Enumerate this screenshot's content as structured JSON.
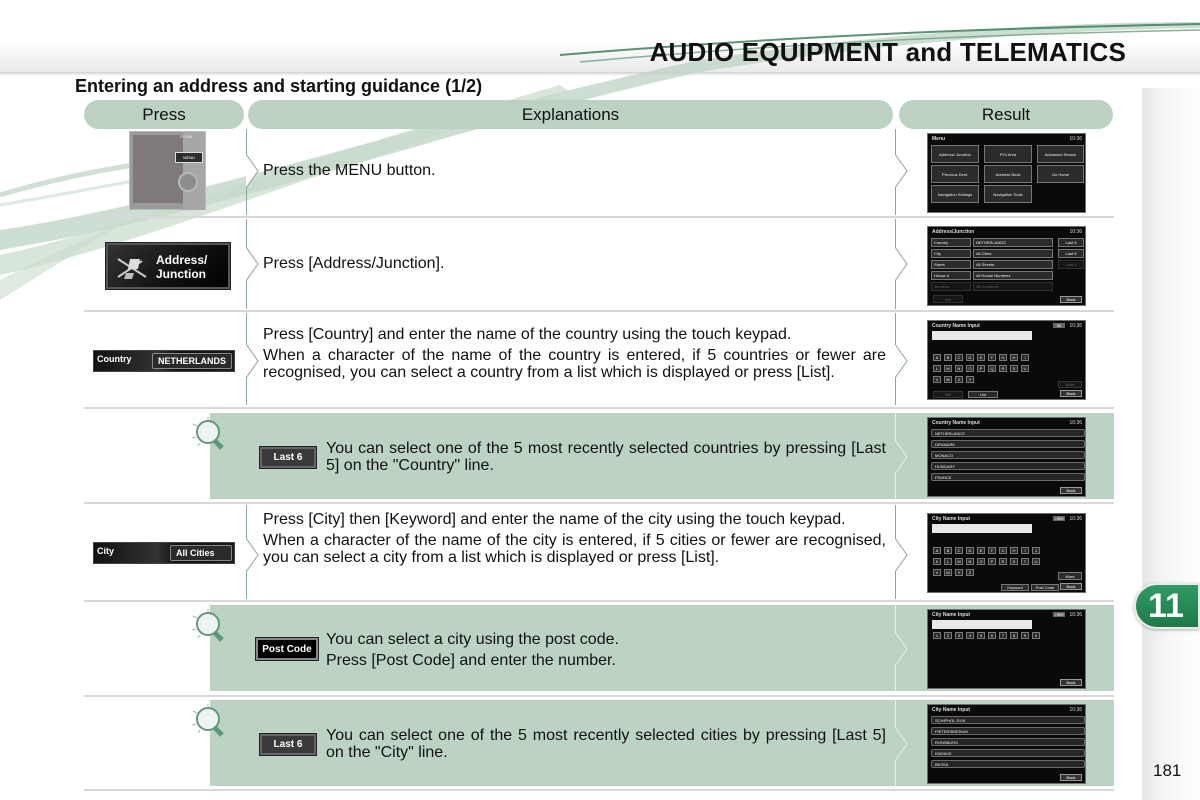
{
  "header": {
    "title": "AUDIO EQUIPMENT and TELEMATICS"
  },
  "section": {
    "title": "Entering an address and starting guidance (1/2)"
  },
  "columns": {
    "press": "Press",
    "explanations": "Explanations",
    "result": "Result"
  },
  "rows": [
    {
      "press": {
        "type": "device",
        "label": "MENU",
        "top_label": "ZOOM"
      },
      "explanations": [
        "Press the MENU button."
      ],
      "result": {
        "title": "Menu",
        "time": "10:36",
        "buttons": [
          "Address/ Junction",
          "POI Area",
          "Advanced Search",
          "Previous Dest.",
          "Address Book",
          "Go Home",
          "Navigation Settings",
          "Navigation Tools"
        ]
      }
    },
    {
      "press": {
        "type": "button",
        "label": "Address/ Junction"
      },
      "explanations": [
        "Press [Address/Junction]."
      ],
      "result": {
        "title": "Address/Junction",
        "time": "10:36",
        "fields": [
          {
            "label": "Country",
            "value": "NETHERLANDS",
            "action": "Last 5"
          },
          {
            "label": "City",
            "value": "All Cities",
            "action": "Last 5"
          },
          {
            "label": "Street",
            "value": "All Streets",
            "action": "Last 5"
          },
          {
            "label": "House #",
            "value": "All House Numbers",
            "action": ""
          },
          {
            "label": "Junction",
            "value": "All Junctions",
            "action": ""
          }
        ],
        "set": "Set",
        "back": "Back"
      }
    },
    {
      "press": {
        "type": "field",
        "label": "Country",
        "value": "NETHERLANDS"
      },
      "explanations": [
        "Press [Country] and enter the name of the country using the touch keypad.",
        "When a character of the name of the country is entered, if 5 countries or fewer are recognised, you can select a country from a list which is displayed or press [List]."
      ],
      "result": {
        "title": "Country Name Input",
        "time": "10:36",
        "badge": "52",
        "keys": [
          "A",
          "B",
          "C",
          "D",
          "E",
          "F",
          "G",
          "H",
          "I",
          "L",
          "M",
          "N",
          "O",
          "P",
          "Q",
          "R",
          "S",
          "U",
          "V",
          "W",
          "X",
          "Y"
        ],
        "set": "Set",
        "list": "List",
        "more": "More",
        "back": "Back"
      }
    },
    {
      "tip": true,
      "press": {
        "type": "button",
        "label": "Last 6"
      },
      "explanations": [
        "You can select one of the 5 most recently selected countries by pressing [Last 5] on the \"Country\" line."
      ],
      "result": {
        "title": "Country Name Input",
        "time": "10:36",
        "items": [
          "NETHERLANDS",
          "DENMARK",
          "MONACO",
          "HUNGARY",
          "FRANCE"
        ],
        "back": "Back"
      }
    },
    {
      "press": {
        "type": "field",
        "label": "City",
        "value": "All Cities"
      },
      "explanations": [
        "Press [City] then [Keyword] and enter the name of the city using the touch keypad.",
        "When a character of the name of the city is entered, if 5 cities or fewer are recognised, you can select a city from a list which is displayed or press [List]."
      ],
      "result": {
        "title": "City Name Input",
        "time": "10:36",
        "badge": ">900",
        "keys": [
          "A",
          "B",
          "C",
          "D",
          "E",
          "F",
          "G",
          "H",
          "I",
          "J",
          "K",
          "L",
          "M",
          "N",
          "O",
          "P",
          "R",
          "S",
          "T",
          "U",
          "V",
          "W",
          "Y",
          "Z"
        ],
        "more": "More",
        "keyword": "Keyword",
        "postcode": "Post Code",
        "back": "Back"
      }
    },
    {
      "tip": true,
      "press": {
        "type": "button",
        "label": "Post Code"
      },
      "explanations": [
        "You can select a city using the post code.",
        "Press [Post Code] and enter the number."
      ],
      "result": {
        "title": "City Name Input",
        "time": "10:36",
        "badge": ">900",
        "keys": [
          "1",
          "2",
          "3",
          "4",
          "5",
          "6",
          "7",
          "8",
          "9",
          "0"
        ],
        "back": "Back"
      }
    },
    {
      "tip": true,
      "press": {
        "type": "button",
        "label": "Last 6"
      },
      "explanations": [
        "You can select one of the 5 most recently selected cities by pressing [Last 5] on the \"City\" line."
      ],
      "result": {
        "title": "City Name Input",
        "time": "10:36",
        "items": [
          "SCHIPHOL-RIJK",
          "PIETERSBIERUM",
          "RIJNSBURG",
          "KNOKKE",
          "BESSA"
        ],
        "back": "Back"
      }
    }
  ],
  "chapter": {
    "number": "11",
    "color": "#238454"
  },
  "page": {
    "number": "181"
  },
  "colors": {
    "header_pill": "#bcd3c3",
    "tip_bg": "#bcd3c3",
    "accent_green": "#238454"
  }
}
